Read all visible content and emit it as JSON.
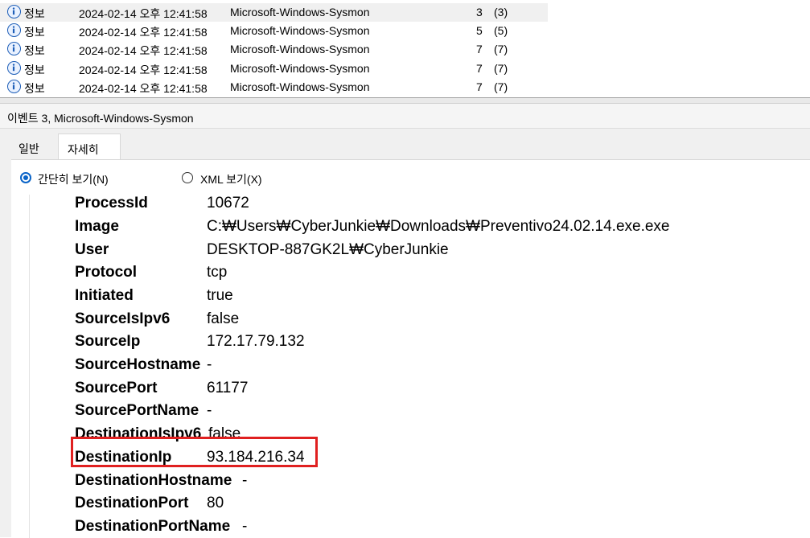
{
  "event_list": {
    "rows": [
      {
        "level": "정보",
        "date": "2024-02-14 오후 12:41:58",
        "source": "Microsoft-Windows-Sysmon",
        "event_id": "3",
        "category": "(3)"
      },
      {
        "level": "정보",
        "date": "2024-02-14 오후 12:41:58",
        "source": "Microsoft-Windows-Sysmon",
        "event_id": "5",
        "category": "(5)"
      },
      {
        "level": "정보",
        "date": "2024-02-14 오후 12:41:58",
        "source": "Microsoft-Windows-Sysmon",
        "event_id": "7",
        "category": "(7)"
      },
      {
        "level": "정보",
        "date": "2024-02-14 오후 12:41:58",
        "source": "Microsoft-Windows-Sysmon",
        "event_id": "7",
        "category": "(7)"
      },
      {
        "level": "정보",
        "date": "2024-02-14 오후 12:41:58",
        "source": "Microsoft-Windows-Sysmon",
        "event_id": "7",
        "category": "(7)"
      }
    ],
    "level_icon": "info-icon"
  },
  "detail": {
    "title": "이벤트 3, Microsoft-Windows-Sysmon",
    "tabs": [
      {
        "label": "일반"
      },
      {
        "label": "자세히"
      }
    ],
    "view_options": {
      "friendly": "간단히 보기(N)",
      "xml": "XML 보기(X)"
    },
    "fields": [
      {
        "key": "ProcessId",
        "value": "10672"
      },
      {
        "key": "Image",
        "value": "C:₩Users₩CyberJunkie₩Downloads₩Preventivo24.02.14.exe.exe"
      },
      {
        "key": "User",
        "value": "DESKTOP-887GK2L₩CyberJunkie"
      },
      {
        "key": "Protocol",
        "value": "tcp"
      },
      {
        "key": "Initiated",
        "value": "true"
      },
      {
        "key": "SourceIsIpv6",
        "value": "false"
      },
      {
        "key": "SourceIp",
        "value": "172.17.79.132"
      },
      {
        "key": "SourceHostname",
        "value": "-"
      },
      {
        "key": "SourcePort",
        "value": "61177"
      },
      {
        "key": "SourcePortName",
        "value": "-"
      },
      {
        "key": "DestinationIsIpv6",
        "value": "false"
      },
      {
        "key": "DestinationIp",
        "value": "93.184.216.34"
      },
      {
        "key": "DestinationHostname",
        "value": "-"
      },
      {
        "key": "DestinationPort",
        "value": "80"
      },
      {
        "key": "DestinationPortName",
        "value": "-"
      }
    ]
  },
  "colors": {
    "highlight_border": "#e02020",
    "radio_accent": "#0a64c8",
    "info_icon": "#1f5fb8"
  }
}
